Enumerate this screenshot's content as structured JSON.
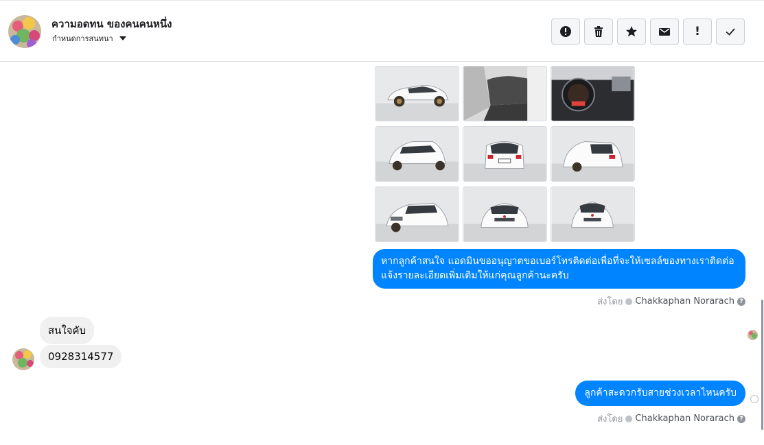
{
  "header": {
    "contact_name": "ความอดทน ของคนคนหนึ่ง",
    "conversation_settings": "กำหนดการสนทนา",
    "actions": [
      {
        "name": "mark-spam",
        "icon": "alert-circle-icon"
      },
      {
        "name": "delete",
        "icon": "trash-icon"
      },
      {
        "name": "star",
        "icon": "star-icon"
      },
      {
        "name": "mark-unread",
        "icon": "envelope-icon"
      },
      {
        "name": "important",
        "icon": "exclamation-icon",
        "label": "!"
      },
      {
        "name": "done",
        "icon": "check-icon"
      }
    ]
  },
  "messages": {
    "photos_count": 9,
    "outgoing_1": "หากลูกค้าสนใจ แอดมินขออนุญาตขอเบอร์โทรติดต่อเพื่อที่จะให้เซลล์ของทางเราติดต่อแจ้งรายละเอียดเพิ่มเติมให้แก่คุณลูกค้านะครับ",
    "sent_by_label": "ส่งโดย",
    "sender_name": "Chakkaphan Norarach",
    "incoming_1": "สนใจคับ",
    "incoming_2": "0928314577",
    "outgoing_2": "ลูกค้าสะดวกรับสายช่วงเวลาไหนครับ"
  },
  "colors": {
    "outgoing_bubble": "#0084ff",
    "incoming_bubble": "#f1f0f0"
  }
}
